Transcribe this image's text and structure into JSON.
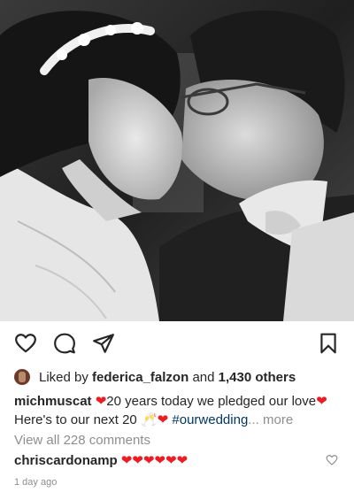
{
  "post": {
    "likes": {
      "prefix": "Liked by",
      "user": "federica_falzon",
      "conjunction": "and",
      "count": "1,430 others"
    },
    "caption": {
      "username": "michmuscat",
      "line1": "20 years today we pledged our love",
      "line2": "Here's to our next 20",
      "hashtag": "#ourwedding",
      "ellipsis": "...",
      "more": "more"
    },
    "view_all_comments": "View all 228 comments",
    "comment": {
      "username": "chriscardonamp",
      "text": "❤❤❤❤❤❤"
    },
    "timestamp": "1 day ago"
  },
  "icons": {
    "like": "heart-outline-icon",
    "comment": "speech-bubble-icon",
    "share": "paper-plane-icon",
    "save": "bookmark-icon",
    "emoji_heart": "red-heart-emoji",
    "emoji_cheers": "champagne-glasses-emoji"
  },
  "colors": {
    "text": "#262626",
    "muted": "#8e8e8e",
    "hashtag": "#00376b",
    "heart": "#ed1c24"
  }
}
